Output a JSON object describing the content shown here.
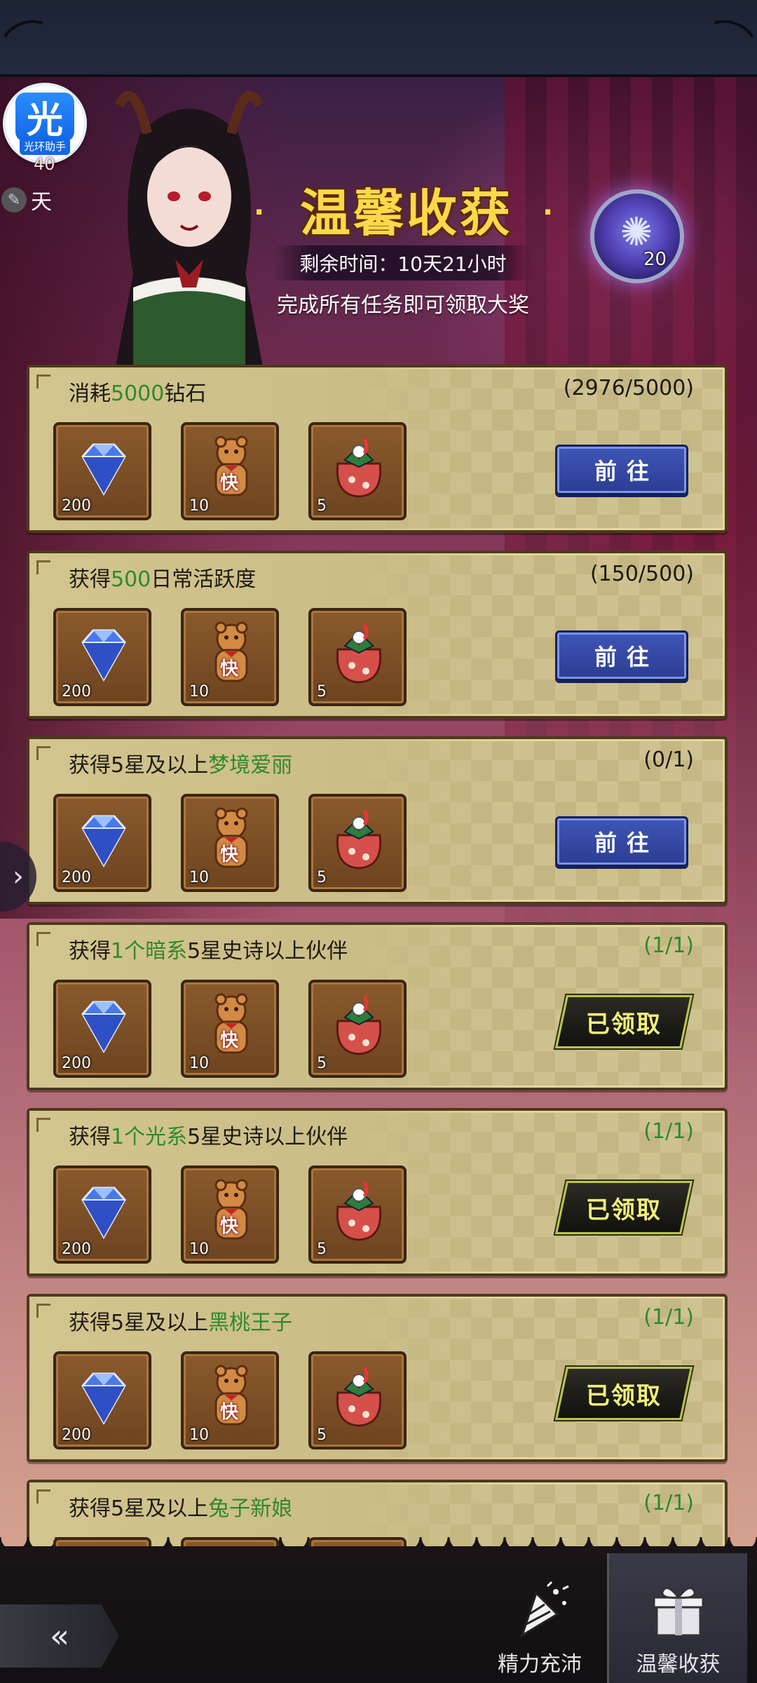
{
  "helper": {
    "big": "光",
    "small": "光环助手"
  },
  "level": "40",
  "chat": {
    "label": "天"
  },
  "title": "温馨收获",
  "timer": "剩余时间：10天21小时",
  "subtitle": "完成所有任务即可领取大奖",
  "medal": {
    "count": "20",
    "icon": "sun-star-medal-icon"
  },
  "tasks": [
    {
      "pre": "消耗",
      "hl": "5000",
      "post": "钻石",
      "progress": "(2976/5000)",
      "status": "go"
    },
    {
      "pre": "获得",
      "hl": "500",
      "post": "日常活跃度",
      "progress": "(150/500)",
      "status": "go"
    },
    {
      "pre": "获得5星及以上",
      "hl": "梦境爱丽",
      "post": "",
      "progress": "(0/1)",
      "status": "go"
    },
    {
      "pre": "获得",
      "hl": "1个暗系",
      "post": "5星史诗以上伙伴",
      "progress": "(1/1)",
      "status": "claimed"
    },
    {
      "pre": "获得",
      "hl": "1个光系",
      "post": "5星史诗以上伙伴",
      "progress": "(1/1)",
      "status": "claimed"
    },
    {
      "pre": "获得5星及以上",
      "hl": "黑桃王子",
      "post": "",
      "progress": "(1/1)",
      "status": "claimed"
    },
    {
      "pre": "获得5星及以上",
      "hl": "兔子新娘",
      "post": "",
      "progress": "(1/1)",
      "status": "claimed"
    }
  ],
  "rewards": [
    {
      "icon": "diamond-icon",
      "qty": "200"
    },
    {
      "icon": "gingerbread-icon",
      "qty": "10",
      "mark": "快"
    },
    {
      "icon": "gift-bag-icon",
      "qty": "5"
    }
  ],
  "buttons": {
    "go": "前往",
    "claimed": "已领取"
  },
  "colors": {
    "highlight": "#2f8a2a",
    "title": "#ffd84a",
    "go_button": "#3f56b8"
  },
  "bottom": {
    "back_icon": "back-arrow-icon",
    "tabs": [
      {
        "label": "精力充沛",
        "icon": "party-popper-icon"
      },
      {
        "label": "温馨收获",
        "icon": "gift-box-icon"
      }
    ]
  }
}
